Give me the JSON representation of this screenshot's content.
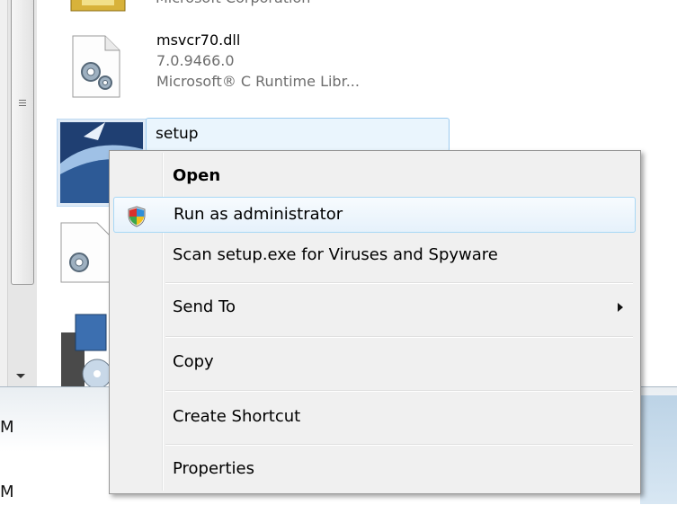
{
  "files": [
    {
      "name": "",
      "details": [
        "Microsoft Corporation"
      ]
    },
    {
      "name": "msvcr70.dll",
      "details": [
        "7.0.9466.0",
        "Microsoft® C Runtime Libr..."
      ]
    },
    {
      "name": "setup",
      "details": []
    }
  ],
  "bottom_letters": [
    "M",
    "M"
  ],
  "context_menu": {
    "items": [
      {
        "label": "Open",
        "bold": true
      },
      {
        "label": "Run as administrator",
        "icon": "uac-shield-icon",
        "highlighted": true
      },
      {
        "label": "Scan setup.exe for Viruses and Spyware"
      },
      {
        "label": "Send To",
        "submenu": true
      },
      {
        "label": "Copy"
      },
      {
        "label": "Create Shortcut"
      },
      {
        "label": "Properties"
      }
    ]
  }
}
